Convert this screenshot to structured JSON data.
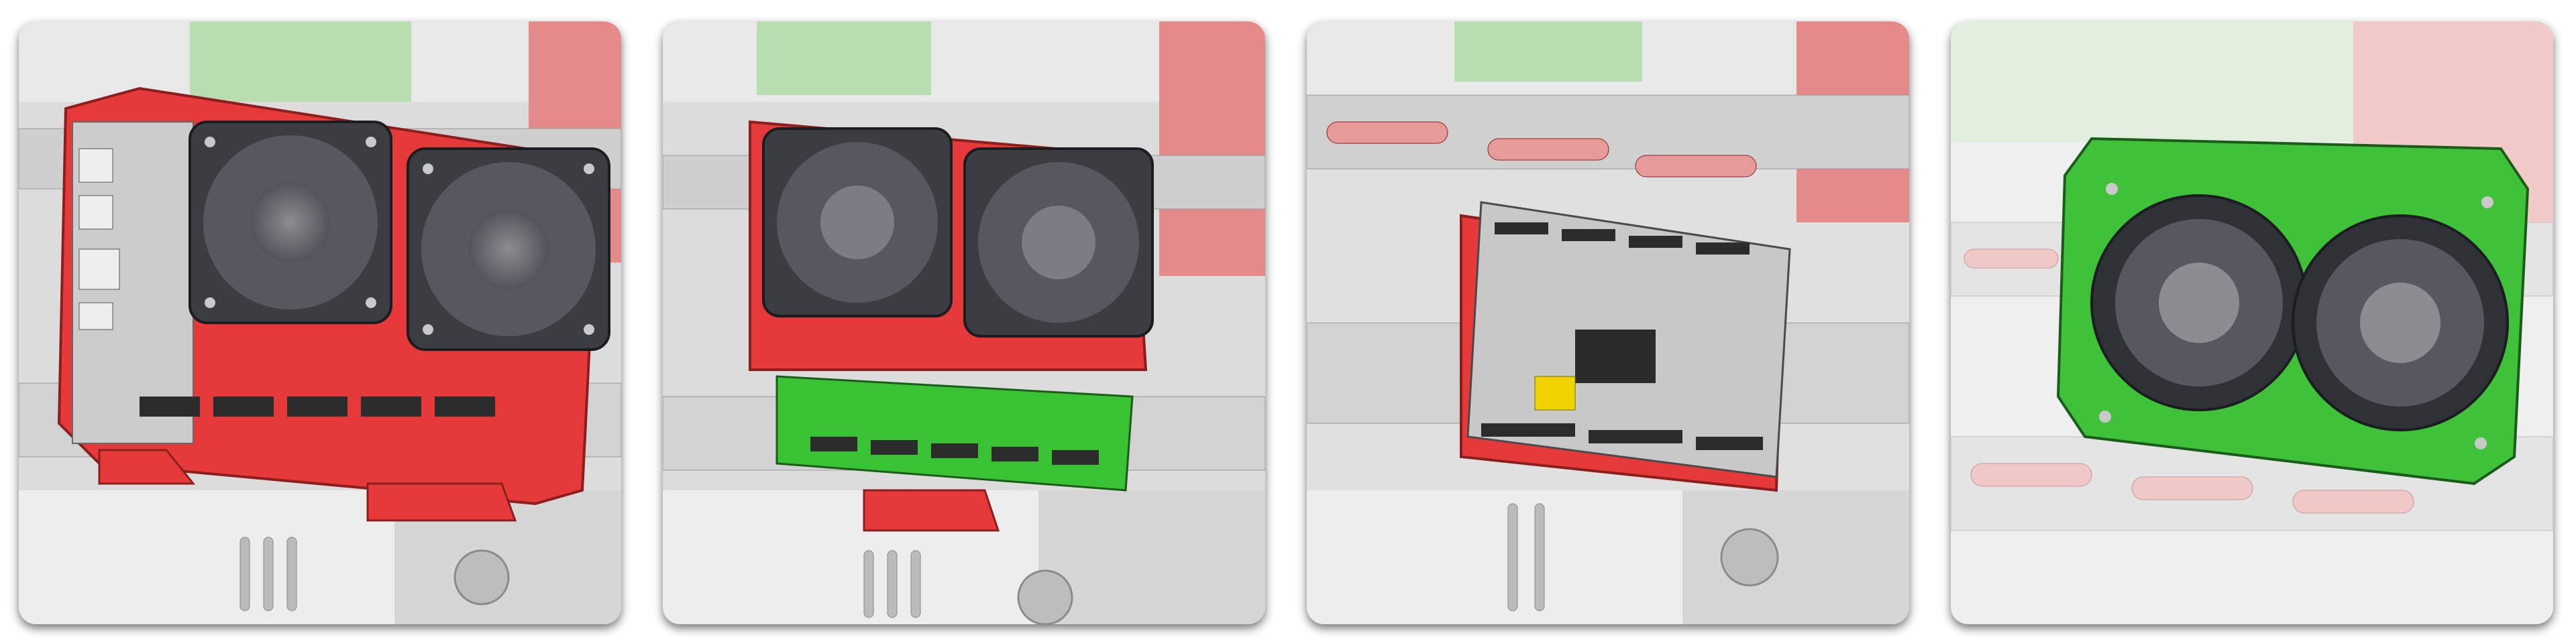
{
  "gallery": {
    "panels": [
      {
        "id": "p1",
        "view": "red-mount-with-board-and-fans"
      },
      {
        "id": "p2",
        "view": "red-mount-with-green-board-and-fans"
      },
      {
        "id": "p3",
        "view": "controller-board-on-red-mount"
      },
      {
        "id": "p4",
        "view": "green-fan-shroud-with-two-fans"
      }
    ]
  },
  "colors": {
    "background": "#ffffff",
    "mount_red": "#e63a3a",
    "accent_green": "#39c233",
    "fan_dark": "#3a3d42",
    "rail_grey": "#cfcfcf"
  }
}
